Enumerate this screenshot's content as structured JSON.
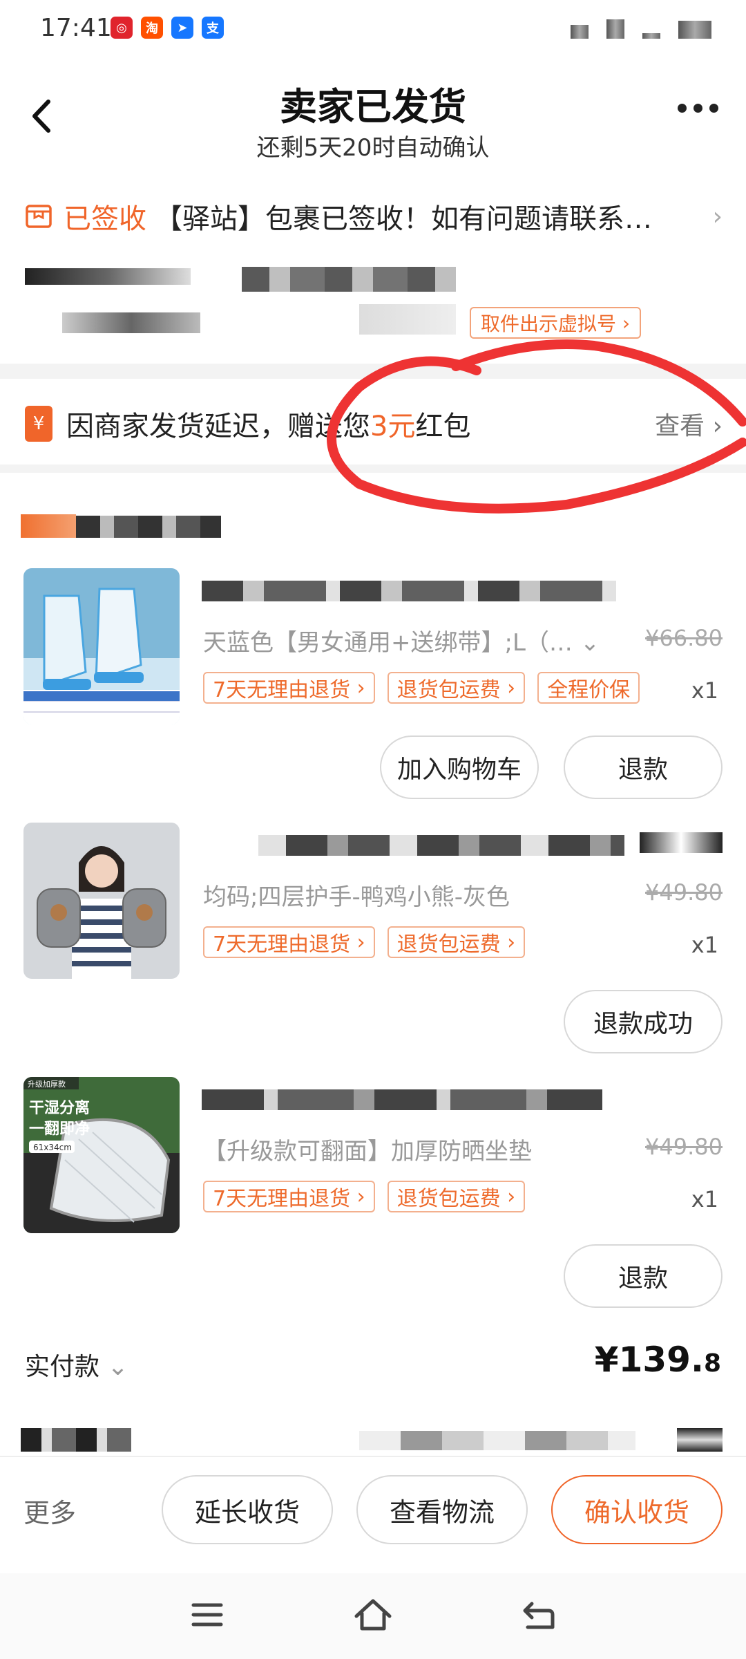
{
  "status_bar": {
    "time": "17:41",
    "apps": [
      {
        "name": "netease-music-icon",
        "glyph": "◎",
        "color": "#e0242c"
      },
      {
        "name": "taobao-icon",
        "glyph": "淘",
        "color": "#ff5000"
      },
      {
        "name": "send-app-icon",
        "glyph": "➤",
        "color": "#1677ff"
      },
      {
        "name": "alipay-icon",
        "glyph": "支",
        "color": "#1677ff"
      }
    ]
  },
  "header": {
    "title": "卖家已发货",
    "subtitle": "还剩5天20时自动确认"
  },
  "logistics": {
    "status": "已签收",
    "text": "【驿站】包裹已签收！如有问题请联系…",
    "pickup_button": "取件出示虚拟号"
  },
  "red_packet": {
    "icon": "¥",
    "text_prefix": "因商家发货延迟，赠送您",
    "amount": "3元",
    "text_suffix": "红包",
    "view_label": "查看"
  },
  "items": [
    {
      "sku": "天蓝色【男女通用+送绑带】;L（…",
      "old_price": "¥66.80",
      "tags": [
        "7天无理由退货",
        "退货包运费",
        "全程价保"
      ],
      "qty": "x1",
      "buttons": [
        "加入购物车",
        "退款"
      ]
    },
    {
      "sku": "均码;四层护手-鸭鸡小熊-灰色",
      "old_price": "¥49.80",
      "tags": [
        "7天无理由退货",
        "退货包运费"
      ],
      "qty": "x1",
      "buttons": [
        "退款成功"
      ]
    },
    {
      "sku": "【升级款可翻面】加厚防晒坐垫",
      "old_price": "¥49.80",
      "tags": [
        "7天无理由退货",
        "退货包运费"
      ],
      "qty": "x1",
      "buttons": [
        "退款"
      ],
      "thumb_text": [
        "升级加厚款",
        "干湿分离",
        "一翻即净",
        "61x34cm"
      ]
    }
  ],
  "payment": {
    "label": "实付款",
    "amount_main": "¥139.",
    "amount_decimal": "8"
  },
  "bottom_bar": {
    "more": "更多",
    "extend": "延长收货",
    "logistics": "查看物流",
    "confirm": "确认收货"
  },
  "colors": {
    "accent": "#f0652a",
    "annotation_red": "#ee3333"
  }
}
